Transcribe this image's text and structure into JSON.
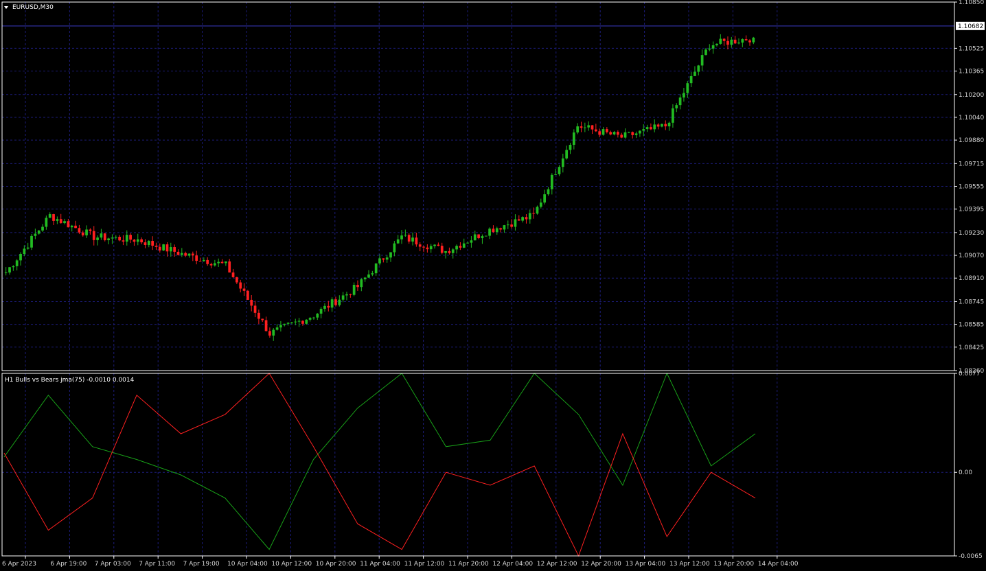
{
  "main_chart": {
    "title": "EURUSD,M30",
    "current_price_label": "1.10682",
    "current_price": 1.10682,
    "y_ticks": [
      "1.10850",
      "1.10682",
      "1.10525",
      "1.10365",
      "1.10200",
      "1.10040",
      "1.09880",
      "1.09715",
      "1.09555",
      "1.09395",
      "1.09230",
      "1.09070",
      "1.08910",
      "1.08745",
      "1.08585",
      "1.08425",
      "1.08260"
    ],
    "ylim": [
      1.0826,
      1.1085
    ],
    "colors": {
      "bull": "#22bb22",
      "bear": "#ff2020",
      "grid": "#1c1c7a",
      "price_line": "#3a3ac8",
      "frame": "#ffffff"
    }
  },
  "indicator": {
    "title": "H1 Bulls vs Bears jma(75) -0.0010 0.0014",
    "y_ticks": [
      "0.0077",
      "0.00",
      "-0.0065"
    ],
    "ylim": [
      -0.0065,
      0.0077
    ],
    "colors": {
      "bulls": "#18a018",
      "bears": "#ff2020"
    }
  },
  "x_ticks": [
    "6 Apr 2023",
    "6 Apr 19:00",
    "7 Apr 03:00",
    "7 Apr 11:00",
    "7 Apr 19:00",
    "10 Apr 04:00",
    "10 Apr 12:00",
    "10 Apr 20:00",
    "11 Apr 04:00",
    "11 Apr 12:00",
    "11 Apr 20:00",
    "12 Apr 04:00",
    "12 Apr 12:00",
    "12 Apr 20:00",
    "13 Apr 04:00",
    "13 Apr 12:00",
    "13 Apr 20:00",
    "14 Apr 04:00"
  ],
  "chart_data": [
    {
      "type": "line",
      "title": "EURUSD,M30",
      "xlabel": "",
      "ylabel": "",
      "categories": [
        "6 Apr 2023",
        "6 Apr 19:00",
        "7 Apr 03:00",
        "7 Apr 11:00",
        "7 Apr 19:00",
        "10 Apr 04:00",
        "10 Apr 12:00",
        "10 Apr 20:00",
        "11 Apr 04:00",
        "11 Apr 12:00",
        "11 Apr 20:00",
        "12 Apr 04:00",
        "12 Apr 12:00",
        "12 Apr 20:00",
        "13 Apr 04:00",
        "13 Apr 12:00",
        "13 Apr 20:00",
        "14 Apr 04:00"
      ],
      "series": [
        {
          "values": [
            1.0895,
            1.0935,
            1.092,
            1.0918,
            1.0908,
            1.09,
            1.0852,
            1.0865,
            1.0885,
            1.092,
            1.091,
            1.0925,
            1.0935,
            1.0998,
            1.099,
            1.0998,
            1.1055,
            1.106
          ]
        }
      ],
      "ylim": [
        1.0826,
        1.1085
      ],
      "grid": true
    },
    {
      "type": "line",
      "title": "H1 Bulls vs Bears jma(75) -0.0010 0.0014",
      "xlabel": "",
      "ylabel": "",
      "categories": [
        "6 Apr 2023",
        "6 Apr 19:00",
        "7 Apr 03:00",
        "7 Apr 11:00",
        "7 Apr 19:00",
        "10 Apr 04:00",
        "10 Apr 12:00",
        "10 Apr 20:00",
        "11 Apr 04:00",
        "11 Apr 12:00",
        "11 Apr 20:00",
        "12 Apr 04:00",
        "12 Apr 12:00",
        "12 Apr 20:00",
        "13 Apr 04:00",
        "13 Apr 12:00",
        "13 Apr 20:00",
        "14 Apr 04:00"
      ],
      "series": [
        {
          "values": [
            0.0012,
            0.006,
            0.002,
            0.001,
            -0.0002,
            -0.002,
            -0.006,
            0.001,
            0.005,
            0.008,
            0.002,
            0.0025,
            0.01,
            0.0045,
            -0.001,
            0.008,
            0.0005,
            0.003
          ]
        },
        {
          "values": [
            0.0015,
            -0.0045,
            -0.002,
            0.006,
            0.003,
            0.0045,
            0.012,
            0.002,
            -0.004,
            -0.006,
            0.0,
            -0.001,
            0.0005,
            -0.008,
            0.003,
            -0.005,
            0.0,
            -0.002
          ]
        }
      ],
      "ylim": [
        -0.0065,
        0.0077
      ],
      "grid": true
    }
  ]
}
